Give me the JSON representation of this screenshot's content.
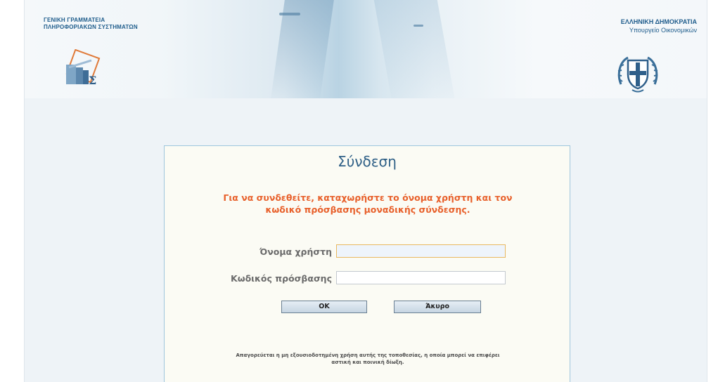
{
  "header": {
    "gsis_line1": "ΓΕΝΙΚΗ ΓΡΑΜΜΑΤΕΙΑ",
    "gsis_line2": "ΠΛΗΡΟΦΟΡΙΑΚΩΝ ΣΥΣΤΗΜΑΤΩΝ",
    "republic": "ΕΛΛΗΝΙΚΗ ΔΗΜΟΚΡΑΤΙΑ",
    "ministry": "Υπουργείο Οικονομικών",
    "gsis_logo_icon": "gsis-logo-icon",
    "emblem_icon": "greek-coat-of-arms-icon"
  },
  "login": {
    "title": "Σύνδεση",
    "instruction_line1": "Για να συνδεθείτε, καταχωρήστε το όνομα χρήστη και τον",
    "instruction_line2": "κωδικό πρόσβασης μοναδικής σύνδεσης.",
    "username_label": "Όνομα χρήστη",
    "username_value": "",
    "password_label": "Κωδικός πρόσβασης",
    "password_value": "",
    "ok_label": "ΟΚ",
    "cancel_label": "Άκυρο",
    "legal_line1": "Απαγορεύεται η μη εξουσιοδοτημένη χρήση αυτής της τοποθεσίας, η οποία μπορεί να επιφέρει",
    "legal_line2": "αστική και ποινική δίωξη."
  },
  "colors": {
    "accent": "#1f5d8c",
    "instruction": "#e8612c",
    "box_border": "#9ec6dd",
    "background": "#eef3f7"
  }
}
